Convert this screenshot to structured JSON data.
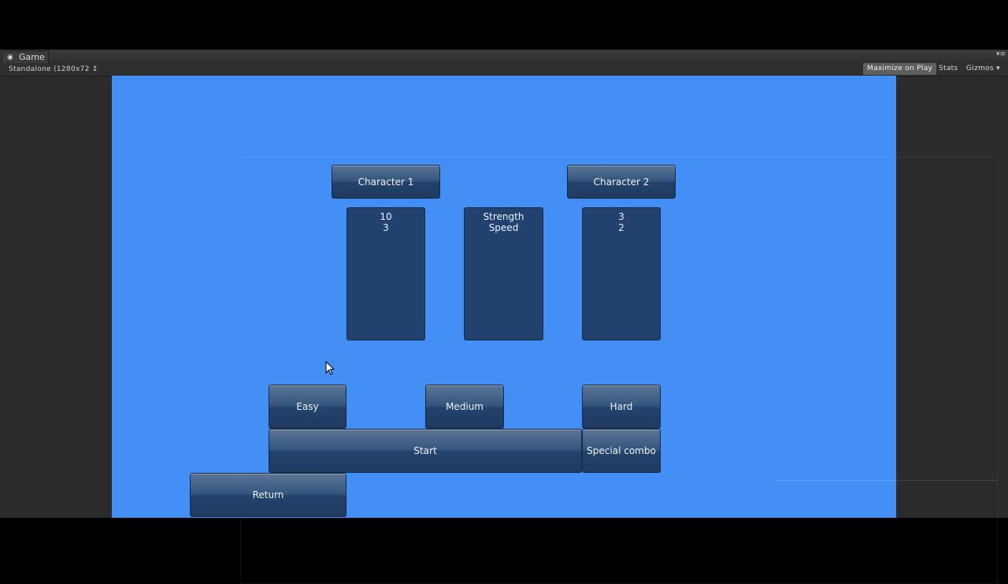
{
  "editor": {
    "tab_title": "Game",
    "resolution": "Standalone (1280x72 ↕",
    "maximize_on_play": "Maximize on Play",
    "stats": "Stats",
    "gizmos": "Gizmos ▾",
    "tab_menu_icon": "▾≡"
  },
  "game": {
    "character1_label": "Character 1",
    "character2_label": "Character 2",
    "char1_stats": [
      "10",
      "3"
    ],
    "stat_names": [
      "Strength",
      "Speed"
    ],
    "char2_stats": [
      "3",
      "2"
    ],
    "difficulty": [
      "Easy",
      "Medium",
      "Hard"
    ],
    "start_label": "Start",
    "special_combo_label": "Special combo",
    "return_label": "Return"
  },
  "colors": {
    "viewport_bg": "#448ff6",
    "panel_bg": "#21416e",
    "editor_bg": "#2b2b2b"
  }
}
